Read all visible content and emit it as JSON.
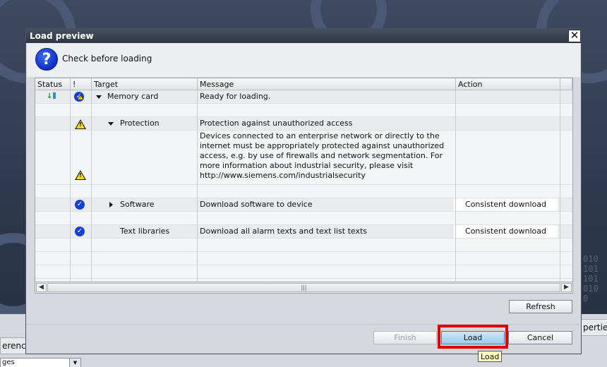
{
  "dialog": {
    "title": "Load preview",
    "header_text": "Check before loading",
    "question_icon_glyph": "?"
  },
  "table": {
    "columns": [
      "Status",
      "!",
      "Target",
      "Message",
      "Action"
    ],
    "rows": [
      {
        "target": "Memory card",
        "message": "Ready for loading.",
        "action": "",
        "status_icon": "download-arrow-icon",
        "flag_icon": "check-warning-icon"
      },
      {
        "target": "Protection",
        "message": "Protection against unauthorized access",
        "action": "",
        "flag_icon": "warning-icon"
      },
      {
        "target": "",
        "message": "Devices connected to an enterprise network or directly to the\ninternet must be appropriately protected against unauthorized\naccess, e.g. by use of firewalls and network segmentation. For\nmore information about industrial security, please visit\nhttp://www.siemens.com/industrialsecurity",
        "action": "",
        "flag_icon": "warning-icon"
      },
      {
        "target": "Software",
        "message": "Download software to device",
        "action": "Consistent download",
        "flag_icon": "check-icon"
      },
      {
        "target": "Text libraries",
        "message": "Download all alarm texts and text list texts",
        "action": "Consistent download",
        "flag_icon": "check-icon"
      }
    ]
  },
  "buttons": {
    "refresh": "Refresh",
    "finish": "Finish",
    "load": "Load",
    "cancel": "Cancel"
  },
  "tooltip": "Load",
  "background": {
    "left_tab_text": "erenc",
    "right_tab_text": "perties",
    "bottom_field_text": "ges",
    "binary_text": "010\n101\n101\n010\n0"
  },
  "colors": {
    "check_blue": "#1540d8",
    "warning_yellow": "#ffd900",
    "highlight_red": "#e00000",
    "tooltip_bg": "#ffffc6"
  }
}
